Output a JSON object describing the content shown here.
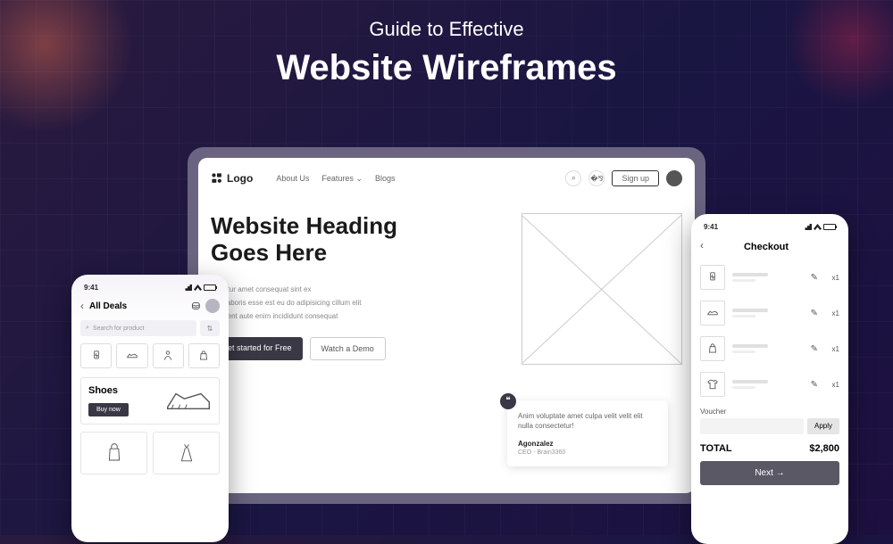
{
  "header": {
    "subtitle": "Guide to Effective",
    "title": "Website Wireframes"
  },
  "laptop": {
    "logo": "Logo",
    "nav": {
      "about": "About Us",
      "features": "Features",
      "blogs": "Blogs"
    },
    "signup": "Sign up",
    "hero": {
      "heading_l1": "Website Heading",
      "heading_l2": "Goes Here",
      "line1": "Pariatur amet consequat sint ex",
      "line2": "Sint laboris esse est eu do adipisicing cillum elit",
      "line3": "Proident aute enim incididunt consequat",
      "cta_primary": "Get started for Free",
      "cta_secondary": "Watch a Demo"
    },
    "quote": {
      "text": "Anim voluptate amet culpa velit velit elit nulla consectetur!",
      "author": "Agonzalez",
      "role": "CEO - Brain3360"
    }
  },
  "phone_left": {
    "time": "9:41",
    "title": "All Deals",
    "search_placeholder": "Search for product",
    "shoes": {
      "title": "Shoes",
      "buy": "Buy now"
    }
  },
  "phone_right": {
    "time": "9:41",
    "title": "Checkout",
    "items": [
      {
        "qty": "x1"
      },
      {
        "qty": "x1"
      },
      {
        "qty": "x1"
      },
      {
        "qty": "x1"
      }
    ],
    "voucher_label": "Voucher",
    "apply": "Apply",
    "total_label": "TOTAL",
    "total_value": "$2,800",
    "next": "Next"
  }
}
